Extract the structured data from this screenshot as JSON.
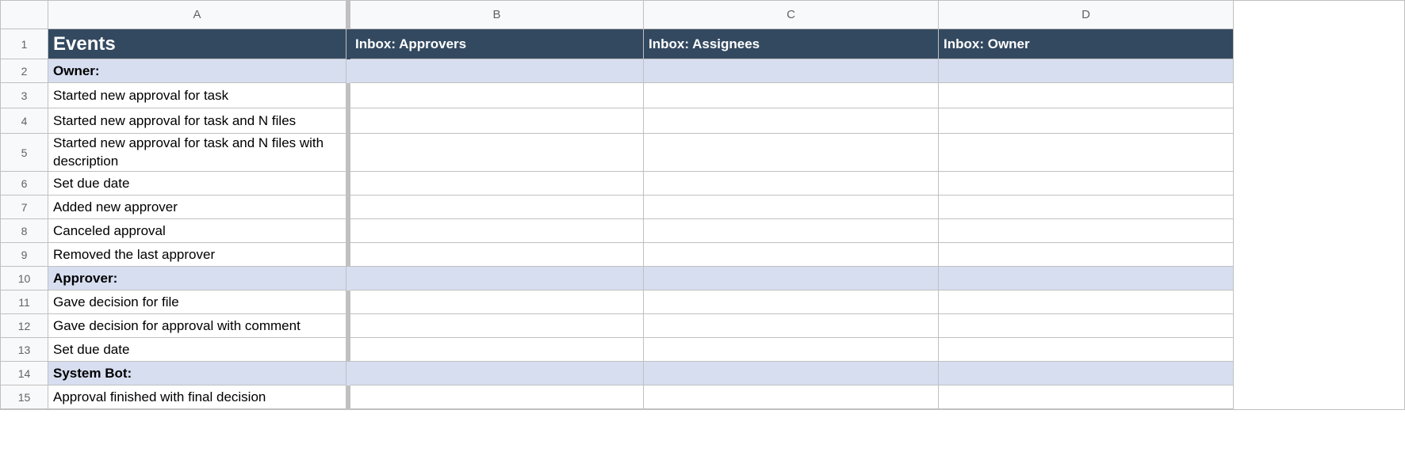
{
  "columns": {
    "A": "A",
    "B": "B",
    "C": "C",
    "D": "D"
  },
  "rowNumbers": [
    "1",
    "2",
    "3",
    "4",
    "5",
    "6",
    "7",
    "8",
    "9",
    "10",
    "11",
    "12",
    "13",
    "14",
    "15"
  ],
  "headers": {
    "events": "Events",
    "inboxApprovers": "Inbox: Approvers",
    "inboxAssignees": "Inbox: Assignees",
    "inboxOwner": "Inbox: Owner"
  },
  "rows": {
    "r2": {
      "a": "Owner:",
      "section": true
    },
    "r3": {
      "a": "Started new approval for task"
    },
    "r4": {
      "a": "Started new approval for task and N files"
    },
    "r5": {
      "a": "Started new approval for task and N files with description"
    },
    "r6": {
      "a": "Set due date"
    },
    "r7": {
      "a": "Added new approver"
    },
    "r8": {
      "a": "Canceled approval"
    },
    "r9": {
      "a": "Removed the last approver"
    },
    "r10": {
      "a": "Approver:",
      "section": true
    },
    "r11": {
      "a": "Gave decision for file"
    },
    "r12": {
      "a": "Gave decision for approval with comment"
    },
    "r13": {
      "a": "Set due date"
    },
    "r14": {
      "a": "System Bot:",
      "section": true
    },
    "r15": {
      "a": "Approval finished with final decision"
    }
  }
}
